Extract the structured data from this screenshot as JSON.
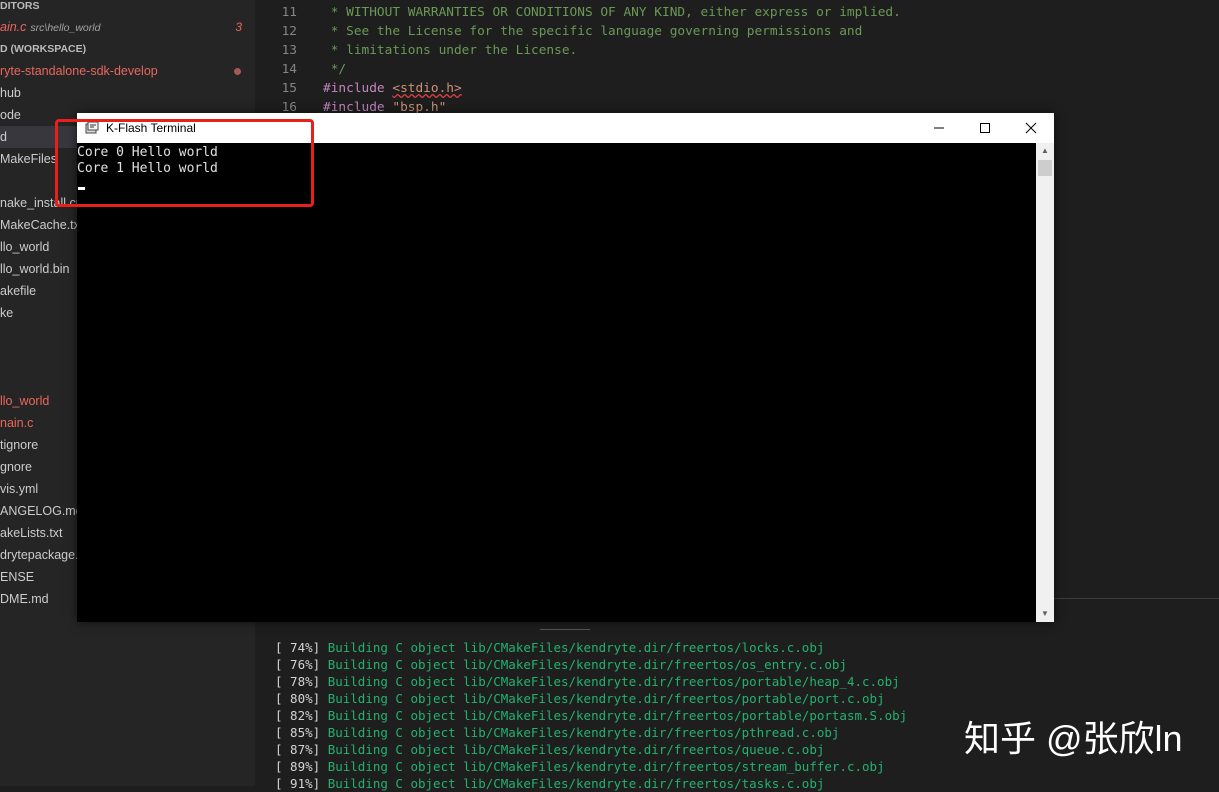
{
  "sidebar": {
    "open_editors_header": "DITORS",
    "open_file": {
      "name": "ain.c",
      "path": "src\\hello_world",
      "problems": "3"
    },
    "workspace_header": "D (WORKSPACE)",
    "items": [
      "ryte-standalone-sdk-develop",
      "hub",
      "ode",
      "d",
      "MakeFiles",
      "",
      "nake_install.cmake",
      "MakeCache.txt",
      "llo_world",
      "llo_world.bin",
      "akefile",
      "ke",
      "",
      "",
      "llo_world",
      "nain.c",
      "tignore",
      "gnore",
      "vis.yml",
      "ANGELOG.md",
      "akeLists.txt",
      "drytepackage.json",
      "ENSE",
      "DME.md"
    ]
  },
  "editor": {
    "lines": [
      {
        "num": "11",
        "text": " * WITHOUT WARRANTIES OR CONDITIONS OF ANY KIND, either express or implied."
      },
      {
        "num": "12",
        "text": " * See the License for the specific language governing permissions and"
      },
      {
        "num": "13",
        "text": " * limitations under the License."
      },
      {
        "num": "14",
        "text": " */"
      },
      {
        "num": "15",
        "keyword": "#include",
        "arg": "<stdio.h>"
      },
      {
        "num": "16",
        "keyword": "#include",
        "arg": "\"bsp.h\""
      }
    ]
  },
  "build_output": [
    {
      "pct": "[ 74%]",
      "msg": "Building C object lib/CMakeFiles/kendryte.dir/freertos/locks.c.obj"
    },
    {
      "pct": "[ 76%]",
      "msg": "Building C object lib/CMakeFiles/kendryte.dir/freertos/os_entry.c.obj"
    },
    {
      "pct": "[ 78%]",
      "msg": "Building C object lib/CMakeFiles/kendryte.dir/freertos/portable/heap_4.c.obj"
    },
    {
      "pct": "[ 80%]",
      "msg": "Building C object lib/CMakeFiles/kendryte.dir/freertos/portable/port.c.obj"
    },
    {
      "pct": "[ 82%]",
      "msg": "Building C object lib/CMakeFiles/kendryte.dir/freertos/portable/portasm.S.obj"
    },
    {
      "pct": "[ 85%]",
      "msg": "Building C object lib/CMakeFiles/kendryte.dir/freertos/pthread.c.obj"
    },
    {
      "pct": "[ 87%]",
      "msg": "Building C object lib/CMakeFiles/kendryte.dir/freertos/queue.c.obj"
    },
    {
      "pct": "[ 89%]",
      "msg": "Building C object lib/CMakeFiles/kendryte.dir/freertos/stream_buffer.c.obj"
    },
    {
      "pct": "[ 91%]",
      "msg": "Building C object lib/CMakeFiles/kendryte.dir/freertos/tasks.c.obj"
    }
  ],
  "kflash": {
    "title": "K-Flash Terminal",
    "output": [
      "Core 0 Hello world",
      "Core 1 Hello world"
    ]
  },
  "watermark": "知乎 @张欣ln",
  "colors": {
    "highlight_box": "#e8201c",
    "error_text": "#e9675d",
    "comment": "#6a9955",
    "build_green": "#23b16f"
  },
  "icons": [
    "terminal-app-icon",
    "minimize-icon",
    "maximize-icon",
    "close-icon",
    "scroll-up-icon",
    "scroll-down-icon"
  ]
}
